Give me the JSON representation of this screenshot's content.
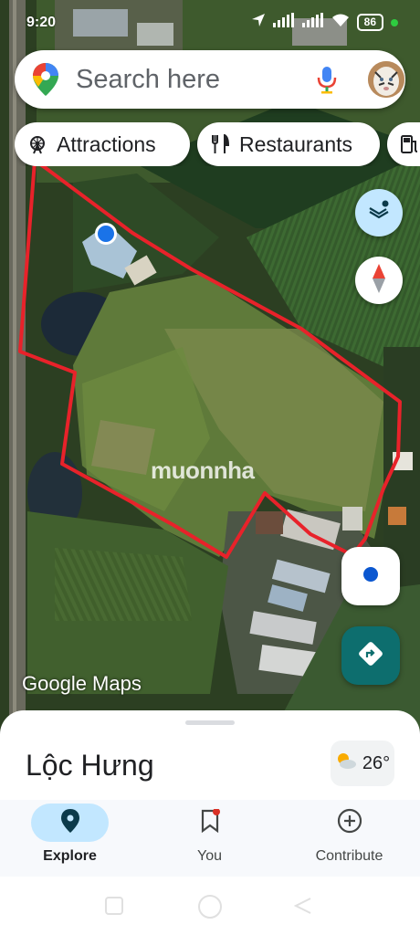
{
  "status_bar": {
    "time": "9:20",
    "battery": "86"
  },
  "search": {
    "placeholder": "Search here"
  },
  "chips": [
    {
      "label": "Attractions",
      "icon": "ferris-wheel-icon"
    },
    {
      "label": "Restaurants",
      "icon": "fork-knife-icon"
    },
    {
      "label": "",
      "icon": "gas-station-icon"
    }
  ],
  "map": {
    "logo_text": "Google Maps",
    "watermark_text": "muonnha",
    "boundary_color": "#e8222a"
  },
  "sheet": {
    "place_name": "Lộc Hưng",
    "temperature": "26°"
  },
  "bottom_nav": [
    {
      "label": "Explore",
      "icon": "explore-pin-icon",
      "active": true
    },
    {
      "label": "You",
      "icon": "bookmark-icon",
      "active": false
    },
    {
      "label": "Contribute",
      "icon": "add-circle-icon",
      "active": false
    }
  ],
  "colors": {
    "accent": "#0b57d0",
    "directions": "#0d6e6e",
    "active_pill": "#c2e7ff"
  }
}
